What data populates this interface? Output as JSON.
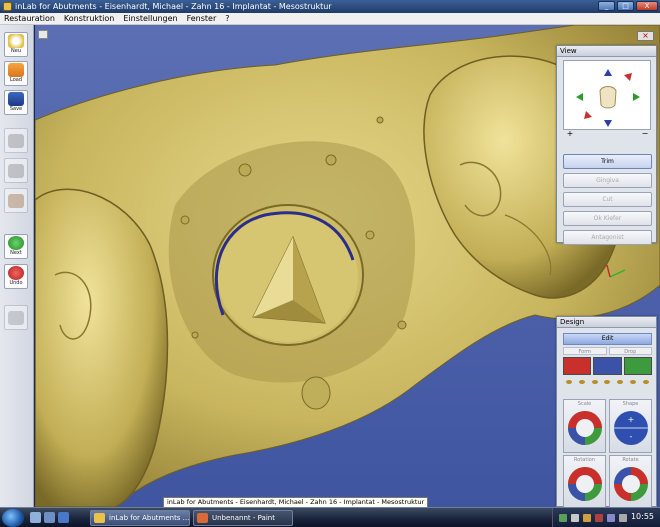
{
  "window": {
    "title": "inLab for Abutments - Eisenhardt, Michael - Zahn  16 - Implantat - Mesostruktur",
    "controls": [
      "_",
      "□",
      "X"
    ]
  },
  "menu": {
    "items": [
      "Restauration",
      "Konstruktion",
      "Einstellungen",
      "Fenster",
      "?"
    ]
  },
  "toolbar": {
    "buttons": [
      {
        "label": "Neu",
        "icon": "new-icon",
        "enabled": true
      },
      {
        "label": "Load",
        "icon": "folder-icon",
        "enabled": true
      },
      {
        "label": "Save",
        "icon": "save-icon",
        "enabled": true
      },
      {
        "label": "",
        "icon": "tooth-gray-icon",
        "enabled": false
      },
      {
        "label": "",
        "icon": "tooth-gray-icon",
        "enabled": false
      },
      {
        "label": "",
        "icon": "tooth-brown-icon",
        "enabled": false
      },
      {
        "label": "Next",
        "icon": "next-arrow-icon",
        "enabled": true
      },
      {
        "label": "Undo",
        "icon": "undo-arrow-icon",
        "enabled": true
      },
      {
        "label": "",
        "icon": "model-icon",
        "enabled": false
      }
    ]
  },
  "view_panel": {
    "title": "View",
    "zoom_in": "+",
    "zoom_out": "−",
    "buttons": [
      {
        "label": "Trim",
        "active": true
      },
      {
        "label": "Gingiva",
        "active": false
      },
      {
        "label": "Cut",
        "active": false
      },
      {
        "label": "Ok Kiefer",
        "active": false
      },
      {
        "label": "Antagonist",
        "active": false
      }
    ]
  },
  "design_panel": {
    "title": "Design",
    "edit_label": "Edit",
    "tabs": [
      "Form",
      "Drop"
    ],
    "tools": [
      {
        "icon": "hand-add-icon",
        "color": "#c9302c"
      },
      {
        "icon": "hand-select-icon",
        "color": "#3a52a8"
      },
      {
        "icon": "hand-smooth-icon",
        "color": "#3d9a3d"
      }
    ],
    "wheels": [
      {
        "label": "Scale",
        "kind": "rgb"
      },
      {
        "label": "Shape",
        "kind": "blue"
      },
      {
        "label": "Rotation",
        "kind": "rgb"
      },
      {
        "label": "Rotate",
        "kind": "rgb"
      }
    ]
  },
  "tooltip": "inLab for Abutments - Eisenhardt, Michael - Zahn  16 - Implantat - Mesostruktur",
  "taskbar": {
    "tasks": [
      {
        "label": "inLab for Abutments ...",
        "active": true
      },
      {
        "label": "Unbenannt - Paint",
        "active": false
      }
    ],
    "clock": "10:55"
  },
  "colors": {
    "model_gold": "#c8b660",
    "background_blue": "#4b5fa8",
    "margin_line": "#2a2e8a"
  }
}
